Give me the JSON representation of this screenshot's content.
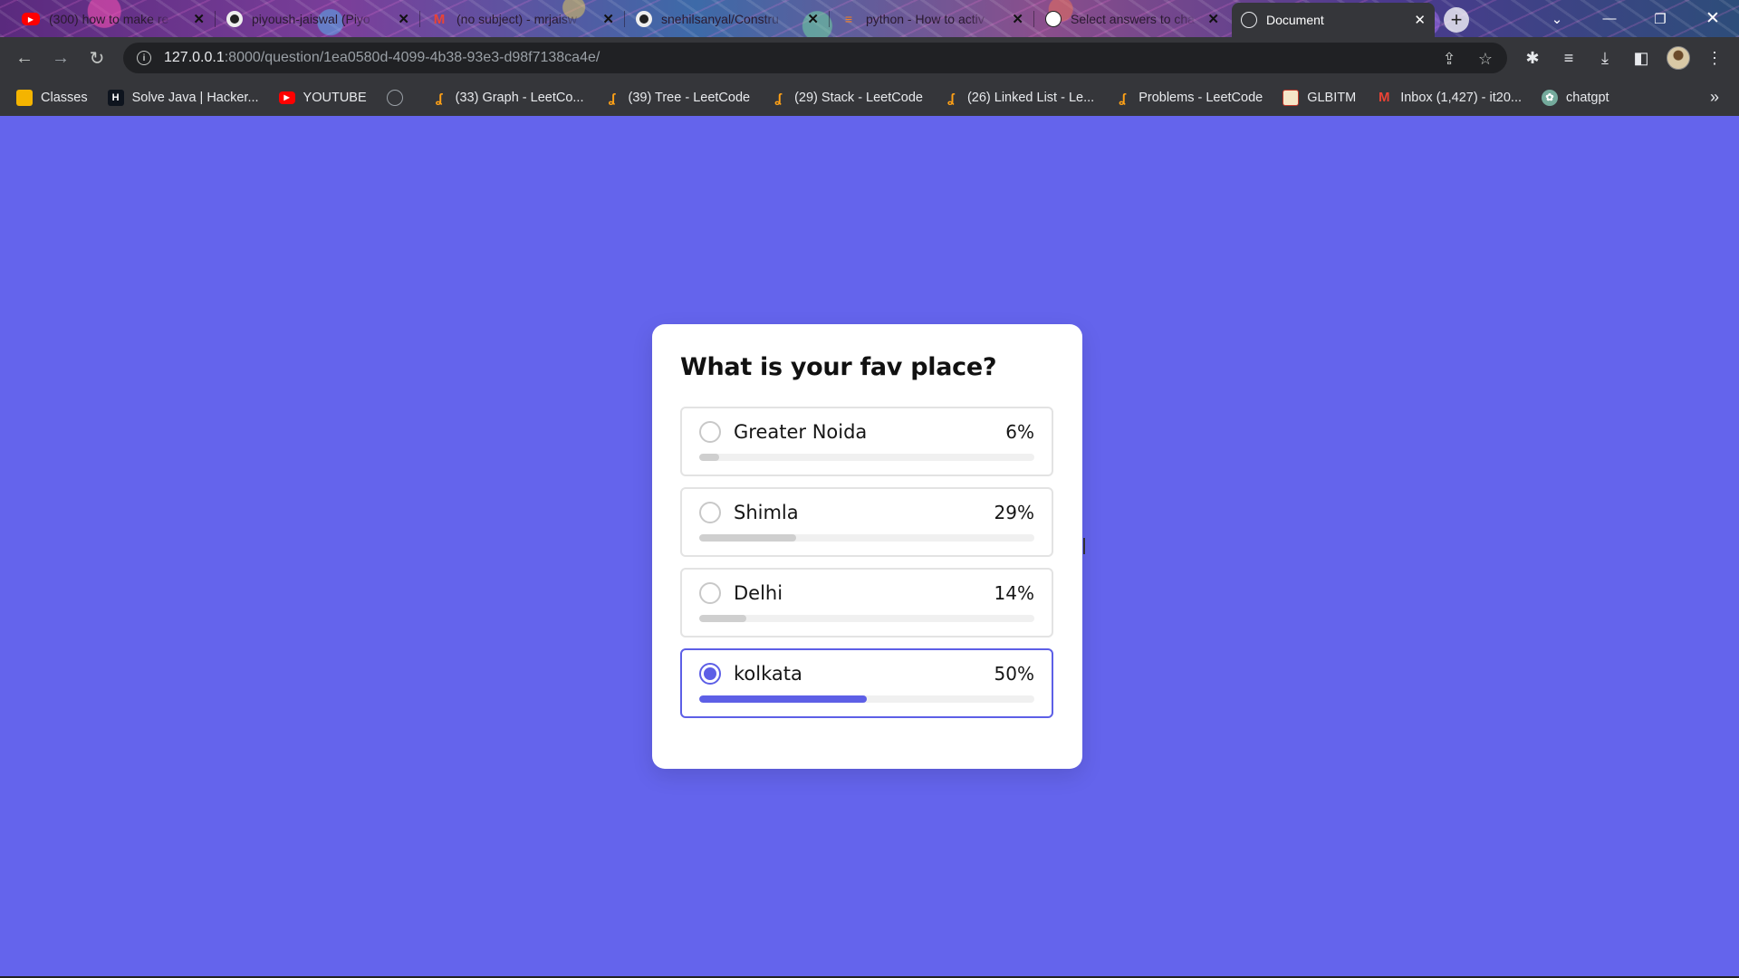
{
  "browser": {
    "tabs": [
      {
        "title": "(300) how to make re",
        "favicon": "youtube-icon",
        "color": "#ff0000"
      },
      {
        "title": "piyoush-jaiswal (Piyo",
        "favicon": "github-icon",
        "color": "#ffffff"
      },
      {
        "title": "(no subject) - mrjaisw",
        "favicon": "gmail-icon",
        "color": "#ea4335"
      },
      {
        "title": "snehilsanyal/Constru",
        "favicon": "github-icon",
        "color": "#ffffff"
      },
      {
        "title": "python - How to activ",
        "favicon": "stackoverflow-icon",
        "color": "#f48024"
      },
      {
        "title": "Select answers to cha",
        "favicon": "globe-icon",
        "color": "#ffffff"
      },
      {
        "title": "Document",
        "favicon": "globe-icon",
        "color": "#ffffff",
        "active": true
      }
    ],
    "address": {
      "host": "127.0.0.1",
      "path": ":8000/question/1ea0580d-4099-4b38-93e3-d98f7138ca4e/"
    },
    "bookmarks": [
      {
        "label": "Classes",
        "icon": "classroom-icon",
        "color": "#f4b400"
      },
      {
        "label": "Solve Java | Hacker...",
        "icon": "hackerrank-icon",
        "color": "#1ba94c"
      },
      {
        "label": "YOUTUBE",
        "icon": "youtube-icon",
        "color": "#ff0000"
      },
      {
        "label": "",
        "icon": "globe-icon",
        "color": "#9aa0a6"
      },
      {
        "label": "(33) Graph - LeetCo...",
        "icon": "leetcode-icon",
        "color": "#ffa116"
      },
      {
        "label": "(39) Tree - LeetCode",
        "icon": "leetcode-icon",
        "color": "#ffa116"
      },
      {
        "label": "(29) Stack - LeetCode",
        "icon": "leetcode-icon",
        "color": "#ffa116"
      },
      {
        "label": "(26) Linked List - Le...",
        "icon": "leetcode-icon",
        "color": "#ffa116"
      },
      {
        "label": "Problems - LeetCode",
        "icon": "leetcode-icon",
        "color": "#ffa116"
      },
      {
        "label": "GLBITM",
        "icon": "college-icon",
        "color": "#c0392b"
      },
      {
        "label": "Inbox (1,427) - it20...",
        "icon": "gmail-icon",
        "color": "#ea4335"
      },
      {
        "label": "chatgpt",
        "icon": "chatgpt-icon",
        "color": "#74aa9c"
      }
    ],
    "more_bookmarks": "»"
  },
  "poll": {
    "question": "What is your fav place?",
    "accent_color": "#5d5fe6",
    "options": [
      {
        "label": "Greater Noida",
        "percent_text": "6%",
        "percent": 6,
        "selected": false
      },
      {
        "label": "Shimla",
        "percent_text": "29%",
        "percent": 29,
        "selected": false
      },
      {
        "label": "Delhi",
        "percent_text": "14%",
        "percent": 14,
        "selected": false
      },
      {
        "label": "kolkata",
        "percent_text": "50%",
        "percent": 50,
        "selected": true
      }
    ]
  },
  "page": {
    "background": "#6464ec"
  }
}
